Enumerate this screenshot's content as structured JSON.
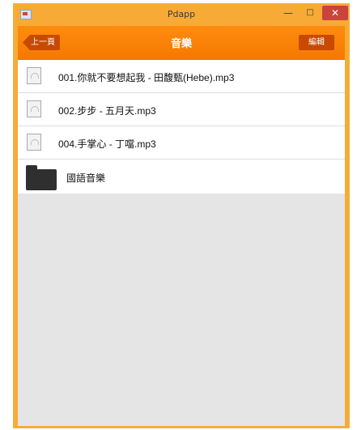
{
  "window": {
    "title": "Pdapp",
    "minimize": "—",
    "maximize": "□",
    "close": "✕"
  },
  "nav": {
    "back_label": "上一頁",
    "title": "音樂",
    "edit_label": "編輯"
  },
  "files": [
    {
      "name": "001.你就不要想起我 - 田馥甄(Hebe).mp3",
      "icon": "audio-file-icon"
    },
    {
      "name": "002.步步 - 五月天.mp3",
      "icon": "audio-file-icon"
    },
    {
      "name": "004.手掌心 - 丁噹.mp3",
      "icon": "audio-file-icon"
    }
  ],
  "folders": [
    {
      "name": "國語音樂",
      "icon": "folder-icon"
    }
  ],
  "colors": {
    "accent": "#f57800",
    "titlebar": "#f7aa36",
    "button": "#c84a00",
    "close": "#c9443a"
  }
}
